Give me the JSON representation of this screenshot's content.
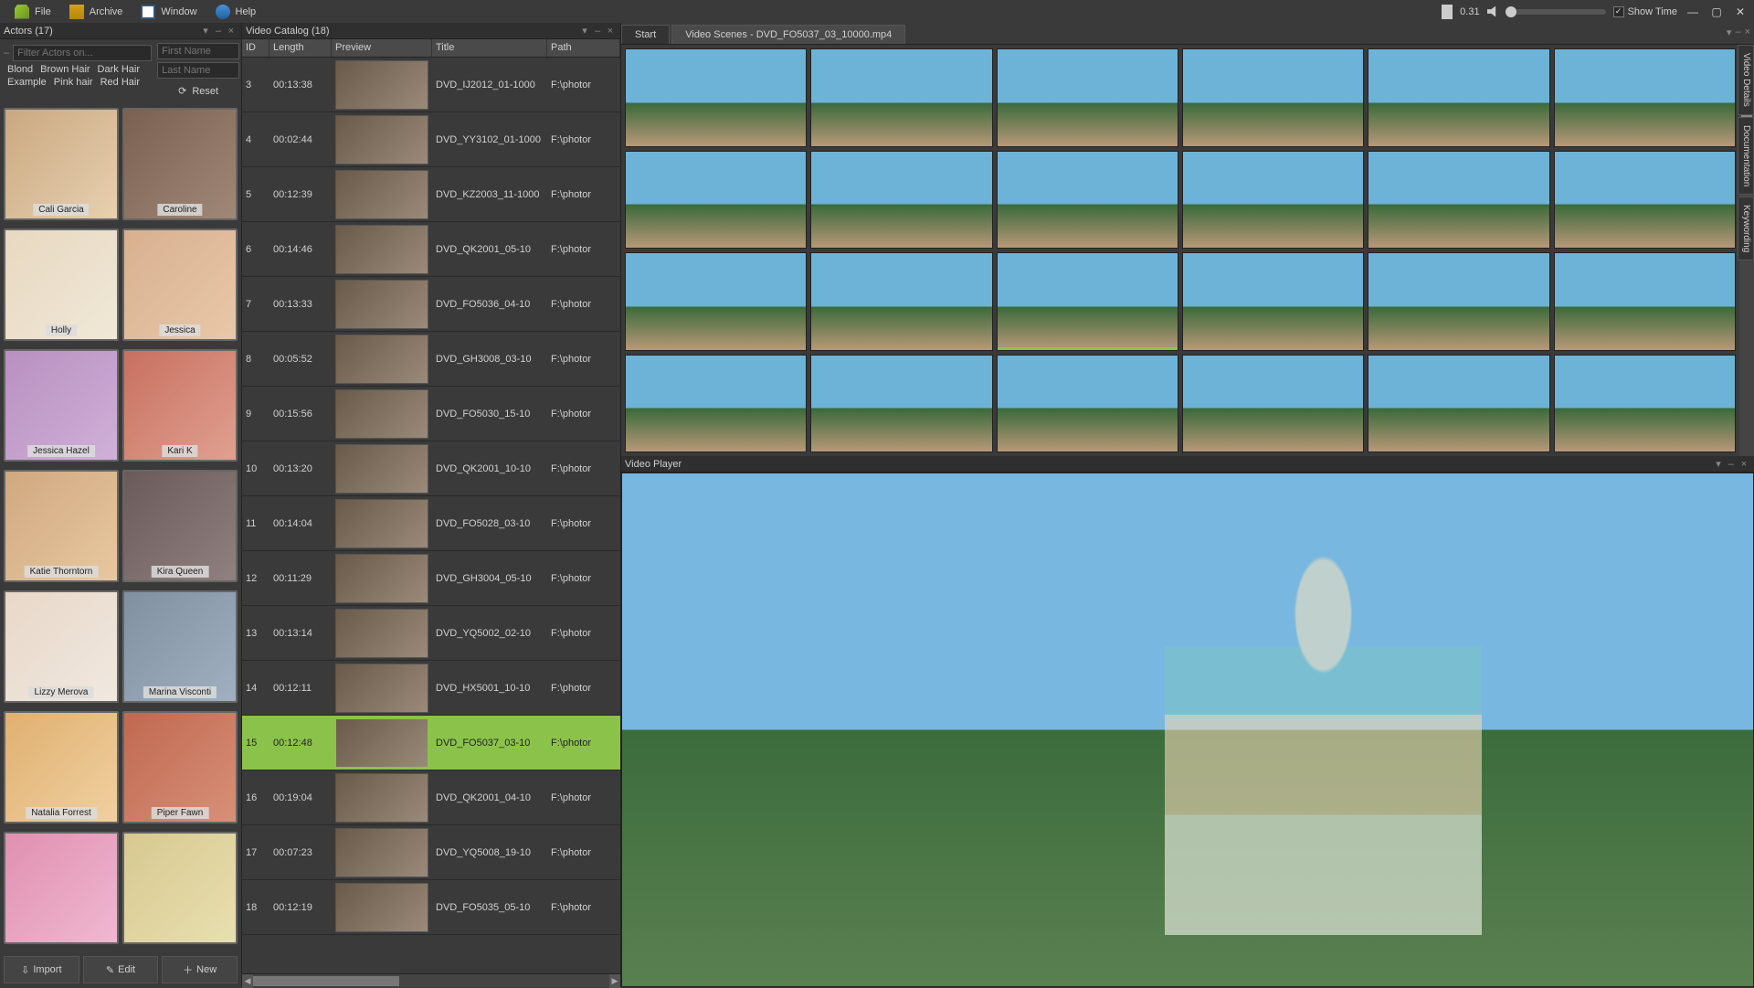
{
  "menubar": {
    "file": "File",
    "archive": "Archive",
    "window": "Window",
    "help": "Help",
    "battery": "0.31",
    "show_time": "Show Time"
  },
  "actors_panel": {
    "title": "Actors (17)",
    "filter_placeholder": "Filter Actors on...",
    "tags": [
      "Blond",
      "Brown Hair",
      "Dark Hair",
      "Example",
      "Pink hair",
      "Red Hair"
    ],
    "first_name_ph": "First Name",
    "last_name_ph": "Last Name",
    "reset": "Reset",
    "actors": [
      "Cali Garcia",
      "Caroline",
      "Holly",
      "Jessica",
      "Jessica Hazel",
      "Kari K",
      "Katie Thorntorn",
      "Kira Queen",
      "Lizzy Merova",
      "Marina Visconti",
      "Natalia Forrest",
      "Piper Fawn",
      "",
      ""
    ],
    "import_btn": "Import",
    "edit_btn": "Edit",
    "new_btn": "New"
  },
  "catalog_panel": {
    "title": "Video Catalog (18)",
    "cols": {
      "id": "ID",
      "length": "Length",
      "preview": "Preview",
      "title": "Title",
      "path": "Path"
    },
    "rows": [
      {
        "id": "3",
        "length": "00:13:38",
        "title": "DVD_IJ2012_01-1000",
        "path": "F:\\photor"
      },
      {
        "id": "4",
        "length": "00:02:44",
        "title": "DVD_YY3102_01-1000",
        "path": "F:\\photor"
      },
      {
        "id": "5",
        "length": "00:12:39",
        "title": "DVD_KZ2003_11-1000",
        "path": "F:\\photor"
      },
      {
        "id": "6",
        "length": "00:14:46",
        "title": "DVD_QK2001_05-10",
        "path": "F:\\photor"
      },
      {
        "id": "7",
        "length": "00:13:33",
        "title": "DVD_FO5036_04-10",
        "path": "F:\\photor"
      },
      {
        "id": "8",
        "length": "00:05:52",
        "title": "DVD_GH3008_03-10",
        "path": "F:\\photor"
      },
      {
        "id": "9",
        "length": "00:15:56",
        "title": "DVD_FO5030_15-10",
        "path": "F:\\photor"
      },
      {
        "id": "10",
        "length": "00:13:20",
        "title": "DVD_QK2001_10-10",
        "path": "F:\\photor"
      },
      {
        "id": "11",
        "length": "00:14:04",
        "title": "DVD_FO5028_03-10",
        "path": "F:\\photor"
      },
      {
        "id": "12",
        "length": "00:11:29",
        "title": "DVD_GH3004_05-10",
        "path": "F:\\photor"
      },
      {
        "id": "13",
        "length": "00:13:14",
        "title": "DVD_YQ5002_02-10",
        "path": "F:\\photor"
      },
      {
        "id": "14",
        "length": "00:12:11",
        "title": "DVD_HX5001_10-10",
        "path": "F:\\photor"
      },
      {
        "id": "15",
        "length": "00:12:48",
        "title": "DVD_FO5037_03-10",
        "path": "F:\\photor",
        "selected": true
      },
      {
        "id": "16",
        "length": "00:19:04",
        "title": "DVD_QK2001_04-10",
        "path": "F:\\photor"
      },
      {
        "id": "17",
        "length": "00:07:23",
        "title": "DVD_YQ5008_19-10",
        "path": "F:\\photor"
      },
      {
        "id": "18",
        "length": "00:12:19",
        "title": "DVD_FO5035_05-10",
        "path": "F:\\photor"
      }
    ]
  },
  "scenes_panel": {
    "tab_start": "Start",
    "tab_active": "Video Scenes - DVD_FO5037_03_10000.mp4",
    "side_tabs": [
      "Video Details",
      "Documentation",
      "Keywording"
    ],
    "scene_count": 24,
    "playing_index": 14
  },
  "player_panel": {
    "title": "Video Player"
  }
}
